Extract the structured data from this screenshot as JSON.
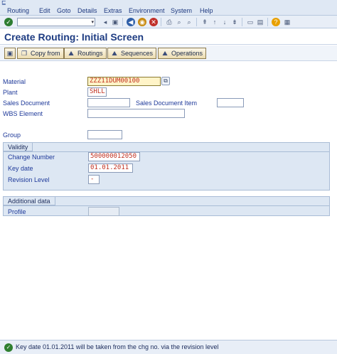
{
  "menu": [
    "Routing",
    "Edit",
    "Goto",
    "Details",
    "Extras",
    "Environment",
    "System",
    "Help"
  ],
  "toolbar": {
    "command_value": ""
  },
  "title": "Create Routing: Initial Screen",
  "app_toolbar": {
    "copy_from": "Copy from",
    "routings": "Routings",
    "sequences": "Sequences",
    "operations": "Operations"
  },
  "form": {
    "material": {
      "label": "Material",
      "value": "ZZZ11DUM00100"
    },
    "plant": {
      "label": "Plant",
      "value": "SHLL"
    },
    "sales_document": {
      "label": "Sales Document",
      "value": ""
    },
    "sales_document_item": {
      "label": "Sales Document Item",
      "value": ""
    },
    "wbs_element": {
      "label": "WBS Element",
      "value": ""
    },
    "group": {
      "label": "Group",
      "value": ""
    }
  },
  "validity": {
    "title": "Validity",
    "change_number": {
      "label": "Change Number",
      "value": "500000012050"
    },
    "key_date": {
      "label": "Key date",
      "value": "01.01.2011"
    },
    "revision_level": {
      "label": "Revision Level",
      "value": "-"
    }
  },
  "additional": {
    "title": "Additional data",
    "profile": {
      "label": "Profile",
      "value": ""
    }
  },
  "status": {
    "type": "success",
    "message": "Key date 01.01.2011 will be taken from the chg no. via the revision level"
  },
  "colors": {
    "title": "#1e3c82",
    "label": "#1f3a9a",
    "field_value": "#c03020",
    "required_field": "#fff4c8"
  }
}
